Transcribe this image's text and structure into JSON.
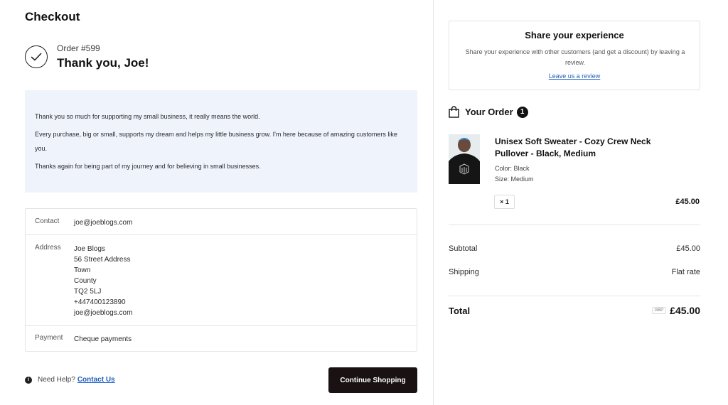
{
  "page": {
    "title": "Checkout"
  },
  "confirmation": {
    "order_number": "Order #599",
    "heading": "Thank you, Joe!"
  },
  "message": {
    "paragraphs": [
      "Thank you so much for supporting my small business, it really means the world.",
      "Every purchase, big or small, supports my dream and helps my little business grow. I'm here because of amazing customers like you.",
      "Thanks again for being part of my journey and for believing in small businesses."
    ]
  },
  "details": {
    "contact_label": "Contact",
    "contact_value": "joe@joeblogs.com",
    "address_label": "Address",
    "address_lines": [
      "Joe Blogs",
      "56 Street Address",
      "Town",
      "County",
      "TQ2 5LJ",
      "+447400123890",
      "joe@joeblogs.com"
    ],
    "payment_label": "Payment",
    "payment_value": "Cheque payments"
  },
  "help": {
    "text": "Need Help?",
    "link": "Contact Us"
  },
  "actions": {
    "continue_label": "Continue Shopping"
  },
  "review": {
    "title": "Share your experience",
    "text": "Share your experience with other customers (and get a discount) by leaving a review.",
    "link": "Leave us a review"
  },
  "order": {
    "heading": "Your Order",
    "count": "1",
    "item": {
      "name": "Unisex Soft Sweater - Cozy Crew Neck Pullover - Black, Medium",
      "color": "Color: Black",
      "size": "Size: Medium",
      "qty": "× 1",
      "price": "£45.00"
    },
    "subtotal_label": "Subtotal",
    "subtotal_value": "£45.00",
    "shipping_label": "Shipping",
    "shipping_value": "Flat rate",
    "total_label": "Total",
    "currency": "GBP",
    "total_value": "£45.00"
  },
  "colors": {
    "accent": "#1f5fbf",
    "button": "#1a1212",
    "message_bg": "#eef3fc"
  }
}
